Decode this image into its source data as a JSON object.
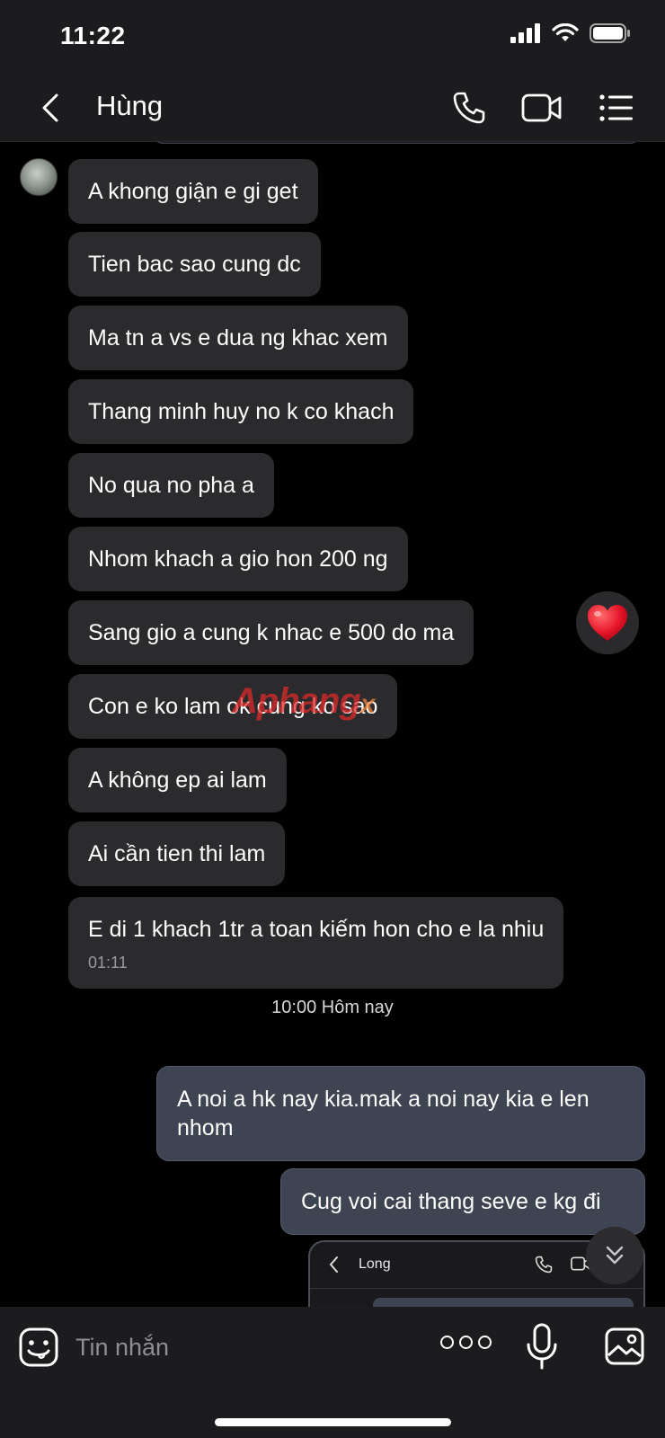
{
  "status_bar": {
    "time": "11:22"
  },
  "header": {
    "contact_name": "Hùng"
  },
  "messages_in": [
    {
      "text": "A khong giận e gi get"
    },
    {
      "text": "Tien bac sao cung dc"
    },
    {
      "text": "Ma tn a vs e dua ng khac xem"
    },
    {
      "text": "Thang minh huy no k co khach"
    },
    {
      "text": "No qua no pha a"
    },
    {
      "text": "Nhom khach a gio hon 200 ng"
    },
    {
      "text": "Sang gio a cung k nhac e 500 do ma"
    },
    {
      "text": "Con e ko lam ok cung ko sao"
    },
    {
      "text": "A không ep ai lam"
    },
    {
      "text": "Ai cần tien thi lam"
    },
    {
      "text": "E di 1 khach 1tr a toan kiếm hon cho e la nhiu",
      "time": "01:11"
    }
  ],
  "reaction": {
    "emoji": "❤️"
  },
  "day_separator": "10:00 Hôm nay",
  "messages_out": [
    {
      "text": "A noi a hk nay kia.mak a noi nay kia e len nhom"
    },
    {
      "text": "Cug voi cai thang seve e kg đi"
    }
  ],
  "shared_screenshot": {
    "contact_name": "Long"
  },
  "watermark": {
    "main": "Aphang",
    "suffix": "x"
  },
  "input": {
    "placeholder": "Tin nhắn"
  },
  "icons": {
    "back": "chevron-left-icon",
    "call": "phone-icon",
    "video": "video-camera-icon",
    "menu": "list-menu-icon",
    "sticker": "sticker-face-icon",
    "more": "more-dots-icon",
    "mic": "microphone-icon",
    "gallery": "image-gallery-icon",
    "scroll_down": "double-chevron-down-icon"
  }
}
